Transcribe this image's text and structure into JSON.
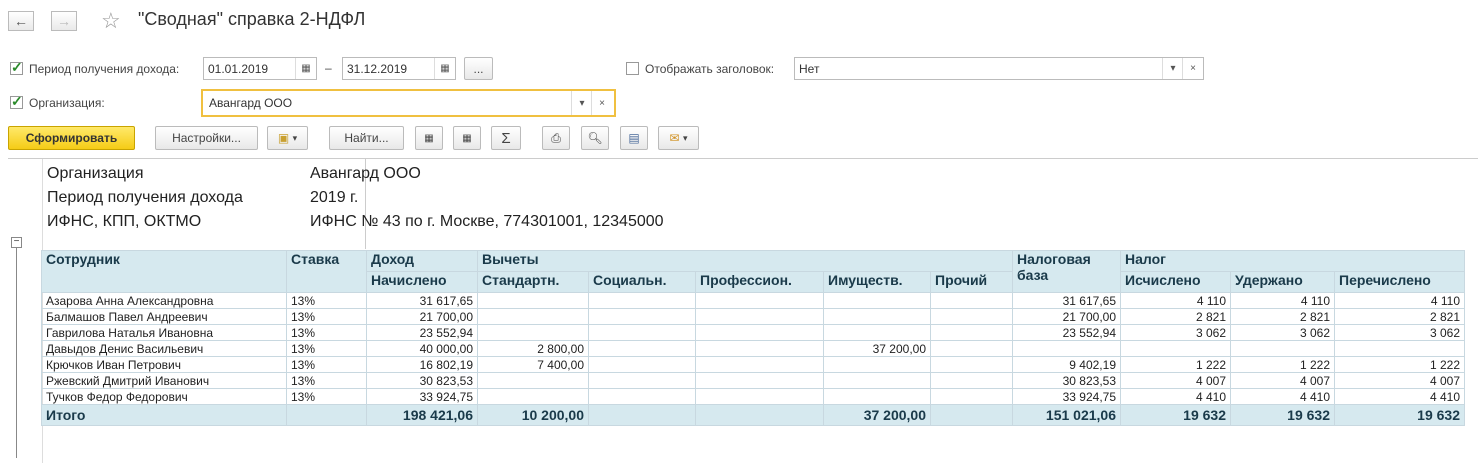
{
  "window": {
    "title": "\"Сводная\" справка 2-НДФЛ"
  },
  "filters": {
    "period_label": "Период получения дохода:",
    "date_from": "01.01.2019",
    "dash": "–",
    "date_to": "31.12.2019",
    "more": "...",
    "show_header_label": "Отображать заголовок:",
    "show_header_value": "Нет",
    "org_label": "Организация:",
    "org_value": "Авангард ООО"
  },
  "toolbar": {
    "generate": "Сформировать",
    "settings": "Настройки...",
    "find": "Найти..."
  },
  "report": {
    "meta": [
      {
        "label": "Организация",
        "value": "Авангард ООО"
      },
      {
        "label": "Период получения дохода",
        "value": "2019 г."
      },
      {
        "label": "ИФНС, КПП, ОКТМО",
        "value": "ИФНС № 43 по г. Москве, 774301001, 12345000"
      }
    ],
    "headers": {
      "employee": "Сотрудник",
      "rate": "Ставка",
      "income": "Доход",
      "accrued": "Начислено",
      "deductions": "Вычеты",
      "standard": "Стандартн.",
      "social": "Социальн.",
      "professional": "Профессион.",
      "property": "Имуществ.",
      "other": "Прочий",
      "tax_base": "Налоговая база",
      "tax": "Налог",
      "calculated": "Исчислено",
      "withheld": "Удержано",
      "transferred": "Перечислено"
    },
    "rows": [
      [
        "Азарова Анна Александровна",
        "13%",
        "31 617,65",
        "",
        "",
        "",
        "",
        "",
        "31 617,65",
        "4 110",
        "4 110",
        "4 110"
      ],
      [
        "Балмашов Павел Андреевич",
        "13%",
        "21 700,00",
        "",
        "",
        "",
        "",
        "",
        "21 700,00",
        "2 821",
        "2 821",
        "2 821"
      ],
      [
        "Гаврилова Наталья Ивановна",
        "13%",
        "23 552,94",
        "",
        "",
        "",
        "",
        "",
        "23 552,94",
        "3 062",
        "3 062",
        "3 062"
      ],
      [
        "Давыдов Денис Васильевич",
        "13%",
        "40 000,00",
        "2 800,00",
        "",
        "",
        "37 200,00",
        "",
        "",
        "",
        "",
        ""
      ],
      [
        "Крючков Иван Петрович",
        "13%",
        "16 802,19",
        "7 400,00",
        "",
        "",
        "",
        "",
        "9 402,19",
        "1 222",
        "1 222",
        "1 222"
      ],
      [
        "Ржевский Дмитрий Иванович",
        "13%",
        "30 823,53",
        "",
        "",
        "",
        "",
        "",
        "30 823,53",
        "4 007",
        "4 007",
        "4 007"
      ],
      [
        "Тучков Федор Федорович",
        "13%",
        "33 924,75",
        "",
        "",
        "",
        "",
        "",
        "33 924,75",
        "4 410",
        "4 410",
        "4 410"
      ]
    ],
    "total": [
      "Итого",
      "",
      "198 421,06",
      "10 200,00",
      "",
      "",
      "37 200,00",
      "",
      "151 021,06",
      "19 632",
      "19 632",
      "19 632"
    ]
  }
}
